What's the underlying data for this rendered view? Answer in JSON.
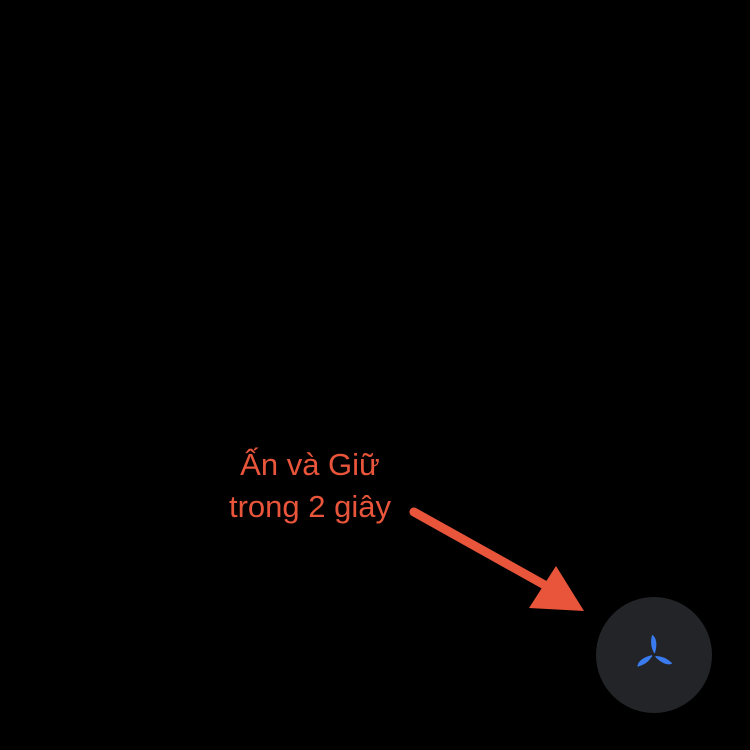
{
  "annotation": {
    "line1": "Ấn và Giữ",
    "line2": "trong 2 giây",
    "color": "#e8553b"
  },
  "button": {
    "icon": "fan-icon",
    "icon_color": "#3a7cf0",
    "background": "#232427"
  }
}
